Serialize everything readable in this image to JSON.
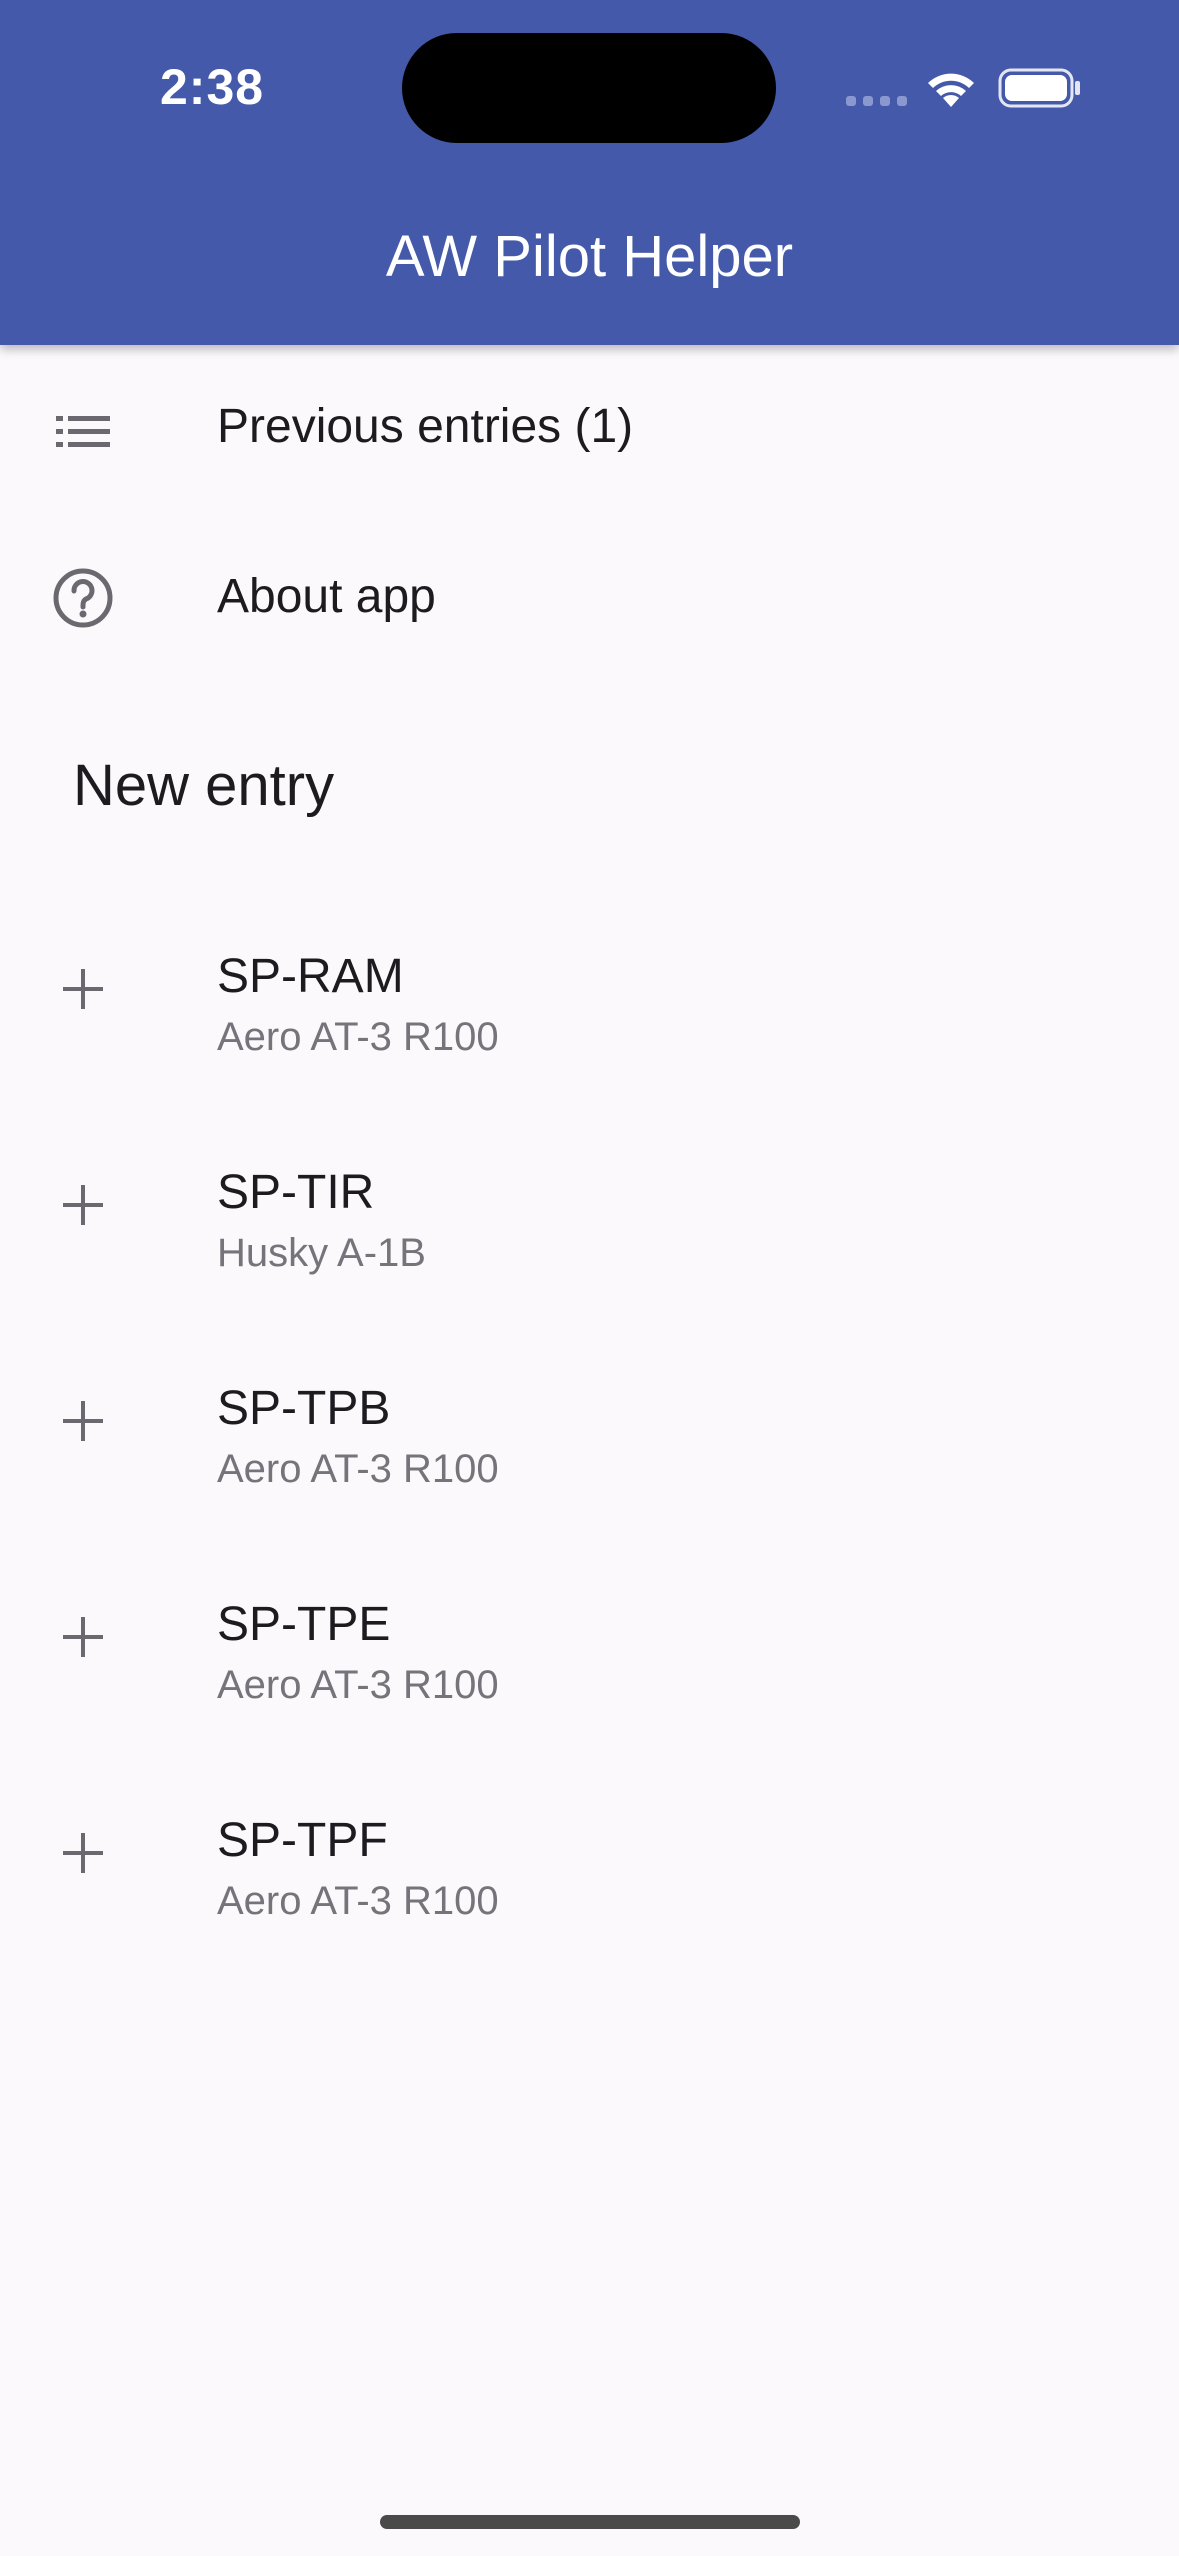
{
  "status_bar": {
    "time": "2:38",
    "icons": [
      "cellular-signal-icon",
      "wifi-icon",
      "battery-icon"
    ]
  },
  "app_bar": {
    "title": "AW Pilot Helper",
    "color": "#4459a9"
  },
  "menu": {
    "previous_entries": {
      "label": "Previous entries (1)",
      "icon": "list-icon"
    },
    "about": {
      "label": "About app",
      "icon": "help-circle-icon"
    }
  },
  "new_entry": {
    "title": "New entry",
    "icon": "plus-icon",
    "aircraft": [
      {
        "registration": "SP-RAM",
        "model": "Aero AT-3 R100"
      },
      {
        "registration": "SP-TIR",
        "model": "Husky A-1B"
      },
      {
        "registration": "SP-TPB",
        "model": "Aero AT-3 R100"
      },
      {
        "registration": "SP-TPE",
        "model": "Aero AT-3 R100"
      },
      {
        "registration": "SP-TPF",
        "model": "Aero AT-3 R100"
      }
    ]
  }
}
